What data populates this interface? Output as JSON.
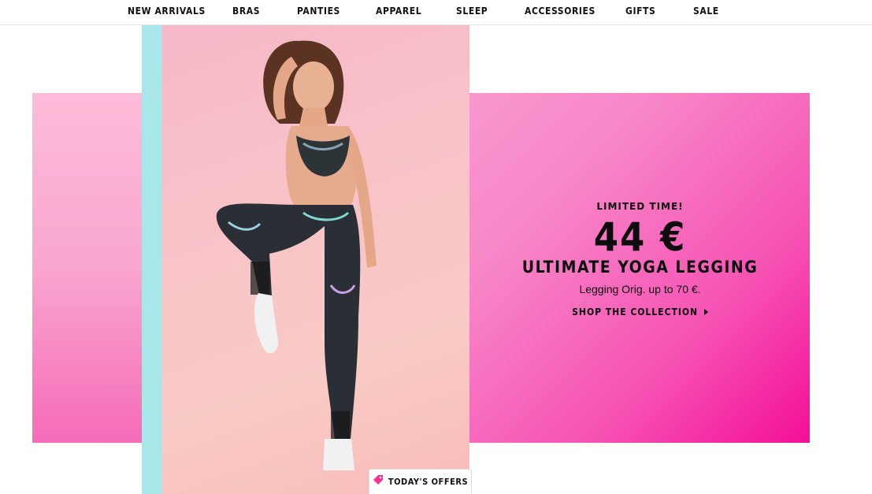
{
  "nav": {
    "items": [
      {
        "label": "NEW ARRIVALS"
      },
      {
        "label": "BRAS"
      },
      {
        "label": "PANTIES"
      },
      {
        "label": "APPAREL"
      },
      {
        "label": "SLEEP"
      },
      {
        "label": "ACCESSORIES"
      },
      {
        "label": "GIFTS"
      },
      {
        "label": "SALE"
      }
    ]
  },
  "promo": {
    "eyebrow": "LIMITED TIME!",
    "price": "44 €",
    "title": "ULTIMATE YOGA LEGGING",
    "subtitle": "Legging Orig. up to 70 €.",
    "cta": "SHOP THE COLLECTION",
    "cta_icon": "chevron-right-icon"
  },
  "offers_tab": {
    "label": "TODAY'S OFFERS",
    "icon": "tag-icon",
    "icon_color": "#ff2f8e"
  },
  "colors": {
    "banner_pink": "#f653b4",
    "teal": "#a9e6ea"
  }
}
